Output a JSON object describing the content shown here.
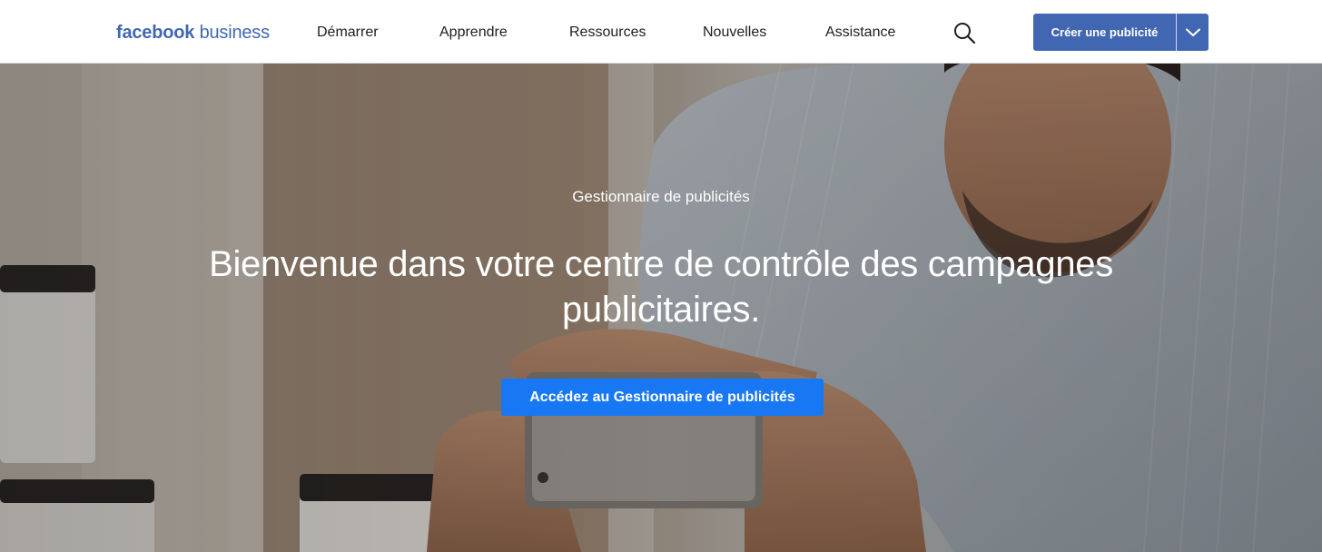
{
  "header": {
    "logo": {
      "brand": "facebook",
      "product": "business"
    },
    "nav": [
      {
        "label": "Démarrer"
      },
      {
        "label": "Apprendre"
      },
      {
        "label": "Ressources"
      },
      {
        "label": "Nouvelles"
      },
      {
        "label": "Assistance"
      }
    ],
    "search_icon": "search-icon",
    "cta": {
      "label": "Créer une publicité",
      "dropdown_icon": "chevron-down-icon"
    }
  },
  "hero": {
    "eyebrow": "Gestionnaire de publicités",
    "headline": "Bienvenue dans votre centre de contrôle des campagnes publicitaires.",
    "cta_label": "Accédez au Gestionnaire de publicités",
    "background_description_icon": "photo-man-with-phone"
  },
  "colors": {
    "brand_blue": "#4267b2",
    "cta_blue": "#1877f2",
    "nav_text": "#1c1e21"
  }
}
